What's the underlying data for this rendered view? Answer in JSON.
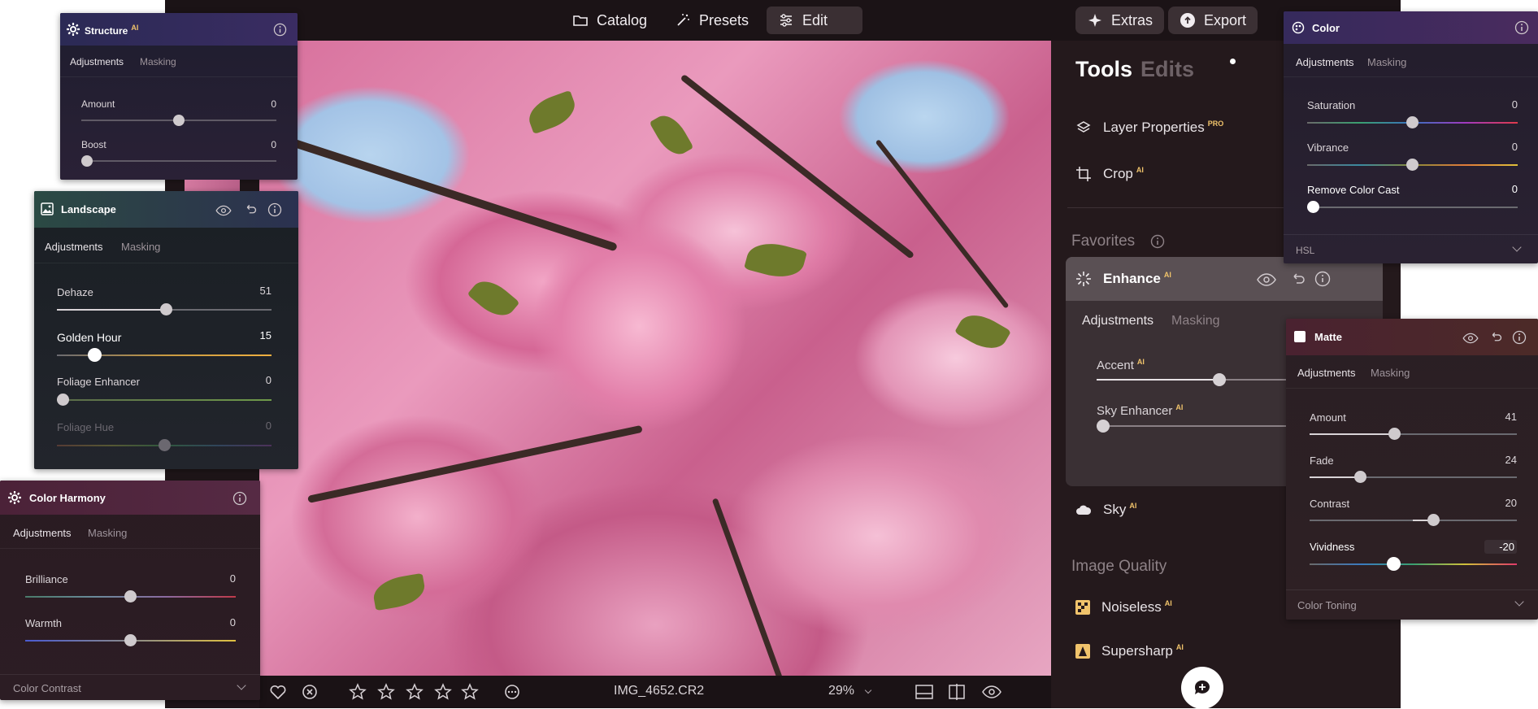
{
  "topbar": {
    "catalog": "Catalog",
    "presets": "Presets",
    "edit": "Edit",
    "extras": "Extras",
    "export": "Export"
  },
  "bottombar": {
    "filename": "IMG_4652.CR2",
    "zoom": "29%"
  },
  "right_panel": {
    "tools": "Tools",
    "edits": "Edits",
    "layer_properties": "Layer Properties",
    "layer_properties_badge": "PRO",
    "crop": "Crop",
    "ai_badge": "AI",
    "favorites": "Favorites",
    "enhance": "Enhance",
    "tabs": [
      "Adjustments",
      "Masking"
    ],
    "accent": "Accent",
    "accent_value": 0.58,
    "sky_enhancer": "Sky Enhancer",
    "sky_enhancer_value": 0.0,
    "sky": "Sky",
    "image_quality": "Image Quality",
    "noiseless": "Noiseless",
    "supersharp": "Supersharp"
  },
  "structure_panel": {
    "title": "Structure",
    "tabs": [
      "Adjustments",
      "Masking"
    ],
    "sliders": [
      {
        "label": "Amount",
        "value": "0"
      },
      {
        "label": "Boost",
        "value": "0"
      }
    ]
  },
  "landscape_panel": {
    "title": "Landscape",
    "tabs": [
      "Adjustments",
      "Masking"
    ],
    "sliders": [
      {
        "label": "Dehaze",
        "value": "51"
      },
      {
        "label": "Golden Hour",
        "value": "15"
      },
      {
        "label": "Foliage Enhancer",
        "value": "0"
      },
      {
        "label": "Foliage Hue",
        "value": "0"
      }
    ]
  },
  "color_harmony_panel": {
    "title": "Color Harmony",
    "tabs": [
      "Adjustments",
      "Masking"
    ],
    "sliders": [
      {
        "label": "Brilliance",
        "value": "0"
      },
      {
        "label": "Warmth",
        "value": "0"
      }
    ],
    "footer": "Color Contrast"
  },
  "color_panel": {
    "title": "Color",
    "tabs": [
      "Adjustments",
      "Masking"
    ],
    "sliders": [
      {
        "label": "Saturation",
        "value": "0"
      },
      {
        "label": "Vibrance",
        "value": "0"
      },
      {
        "label": "Remove Color Cast",
        "value": "0"
      }
    ],
    "footer": "HSL"
  },
  "matte_panel": {
    "title": "Matte",
    "tabs": [
      "Adjustments",
      "Masking"
    ],
    "sliders": [
      {
        "label": "Amount",
        "value": "41"
      },
      {
        "label": "Fade",
        "value": "24"
      },
      {
        "label": "Contrast",
        "value": "20"
      },
      {
        "label": "Vividness",
        "value": "-20"
      }
    ],
    "footer": "Color Toning"
  },
  "colors": {
    "accent_gold": "#f0c36b",
    "app_bg": "#1f1619"
  }
}
